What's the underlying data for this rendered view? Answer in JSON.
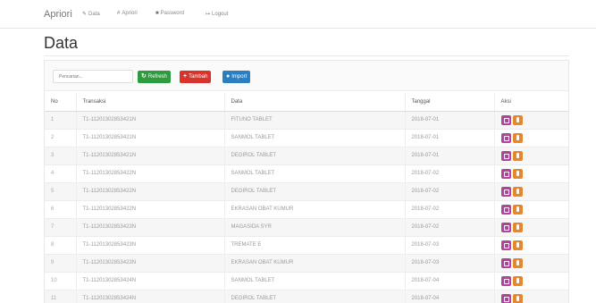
{
  "navbar": {
    "brand": "Apriori",
    "items": [
      {
        "label": "Data",
        "icon": "pencil-icon"
      },
      {
        "label": "Apriori",
        "icon": "hash-icon"
      },
      {
        "label": "Password",
        "icon": "lock-icon"
      },
      {
        "label": "Logout",
        "icon": "logout-icon"
      }
    ]
  },
  "page": {
    "title": "Data"
  },
  "toolbar": {
    "search_placeholder": "Pencarian...",
    "refresh_label": "Refresh",
    "tambah_label": "Tambah",
    "import_label": "Import"
  },
  "colors": {
    "refresh": "#2d9c3f",
    "tambah": "#d9342b",
    "import": "#2a7fc1",
    "edit": "#b0449c",
    "delete": "#e8872a"
  },
  "table": {
    "headers": [
      "No",
      "Transaksi",
      "Data",
      "Tanggal",
      "Aksi"
    ],
    "rows": [
      {
        "no": "1",
        "transaksi": "T1-11201302853421N",
        "data": "FITUNO TABLET",
        "tanggal": "2018-07-01"
      },
      {
        "no": "2",
        "transaksi": "T1-11201302853421N",
        "data": "SANMOL TABLET",
        "tanggal": "2018-07-01"
      },
      {
        "no": "3",
        "transaksi": "T1-11201302853421N",
        "data": "DEGIROL TABLET",
        "tanggal": "2018-07-01"
      },
      {
        "no": "4",
        "transaksi": "T1-11201302853422N",
        "data": "SANMOL TABLET",
        "tanggal": "2018-07-02"
      },
      {
        "no": "5",
        "transaksi": "T1-11201302853422N",
        "data": "DEGIROL TABLET",
        "tanggal": "2018-07-02"
      },
      {
        "no": "6",
        "transaksi": "T1-11201302853422N",
        "data": "EKRASAN OBAT KUMUR",
        "tanggal": "2018-07-02"
      },
      {
        "no": "7",
        "transaksi": "T1-11201302853423N",
        "data": "MAGASIDA SYR",
        "tanggal": "2018-07-02"
      },
      {
        "no": "8",
        "transaksi": "T1-11201302853423N",
        "data": "TREMATE E",
        "tanggal": "2018-07-03"
      },
      {
        "no": "9",
        "transaksi": "T1-11201302853423N",
        "data": "EKRASAN OBAT KUMUR",
        "tanggal": "2018-07-03"
      },
      {
        "no": "10",
        "transaksi": "T1-11201302853424N",
        "data": "SANMOL TABLET",
        "tanggal": "2018-07-04"
      },
      {
        "no": "11",
        "transaksi": "T1-11201302853424N",
        "data": "DEGIROL TABLET",
        "tanggal": "2018-07-04"
      }
    ]
  }
}
